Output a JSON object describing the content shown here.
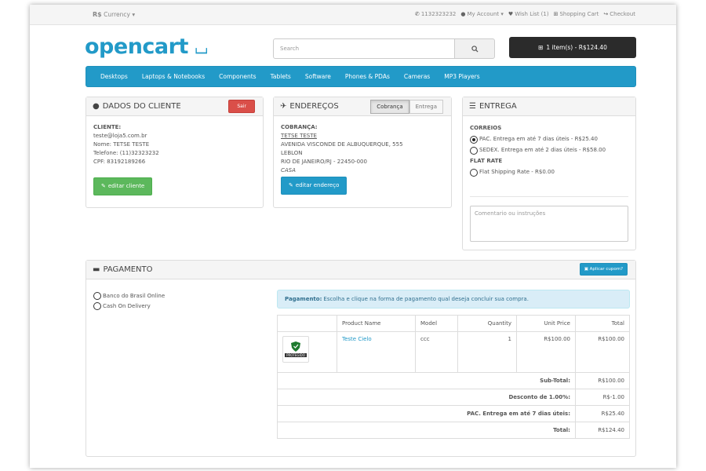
{
  "topbar": {
    "currency_symbol": "R$",
    "currency_label": "Currency",
    "phone": "1132323232",
    "my_account": "My Account",
    "wish_list": "Wish List (1)",
    "shopping_cart": "Shopping Cart",
    "checkout": "Checkout"
  },
  "header": {
    "logo": "opencart",
    "search_placeholder": "Search",
    "cart_button": "1 item(s) - R$124.40"
  },
  "nav": {
    "items": [
      "Desktops",
      "Laptops & Notebooks",
      "Components",
      "Tablets",
      "Software",
      "Phones & PDAs",
      "Cameras",
      "MP3 Players"
    ]
  },
  "cliente": {
    "title": "DADOS DO CLIENTE",
    "logout_label": "Sair",
    "section_label": "CLIENTE:",
    "email": "teste@loja5.com.br",
    "name": "Nome: TETSE TESTE",
    "phone": "Telefone: (11)32323232",
    "cpf": "CPF: 83192189266",
    "edit_label": "editar cliente"
  },
  "enderecos": {
    "title": "ENDEREÇOS",
    "tab_billing": "Cobrança",
    "tab_shipping": "Entrega",
    "section_label": "COBRANÇA:",
    "name": "TETSE TESTE",
    "street": "AVENIDA VISCONDE DE ALBUQUERQUE, 555",
    "district": "LEBLON",
    "city": "RIO DE JANEIRO/RJ - 22450-000",
    "alias": "CASA",
    "edit_label": "editar endereço"
  },
  "entrega": {
    "title": "ENTREGA",
    "group1": "CORREIOS",
    "opt1": "PAC. Entrega em até 7 dias úteis - R$25.40",
    "opt2": "SEDEX. Entrega em até 2 dias úteis - R$58.00",
    "group2": "FLAT RATE",
    "opt3": "Flat Shipping Rate - R$0.00",
    "comment_placeholder": "Comentario ou instruções"
  },
  "pagamento": {
    "title": "PAGAMENTO",
    "coupon_label": "Aplicar cupom?",
    "opt1": "Banco do Brasil Online",
    "opt2": "Cash On Delivery",
    "alert_bold": "Pagamento:",
    "alert_text": "Escolha e clique na forma de pagamento qual deseja concluir sua compra."
  },
  "cart_table": {
    "headers": [
      "Product Name",
      "Model",
      "Quantity",
      "Unit Price",
      "Total"
    ],
    "product": {
      "name": "Teste Cielo",
      "model": "ccc",
      "quantity": "1",
      "unit_price": "R$100.00",
      "total": "R$100.00"
    },
    "thumb_caption": "PROTEGIDO",
    "subtotal_label": "Sub-Total:",
    "subtotal_value": "R$100.00",
    "discount_label": "Desconto de 1.00%:",
    "discount_value": "R$-1.00",
    "shipping_label": "PAC. Entrega em até 7 dias úteis:",
    "shipping_value": "R$25.40",
    "total_label": "Total:",
    "total_value": "R$124.40"
  },
  "colors": {
    "accent": "#229ac8",
    "success": "#5cb85c",
    "danger": "#da4f49",
    "dark": "#2b2b2b"
  }
}
